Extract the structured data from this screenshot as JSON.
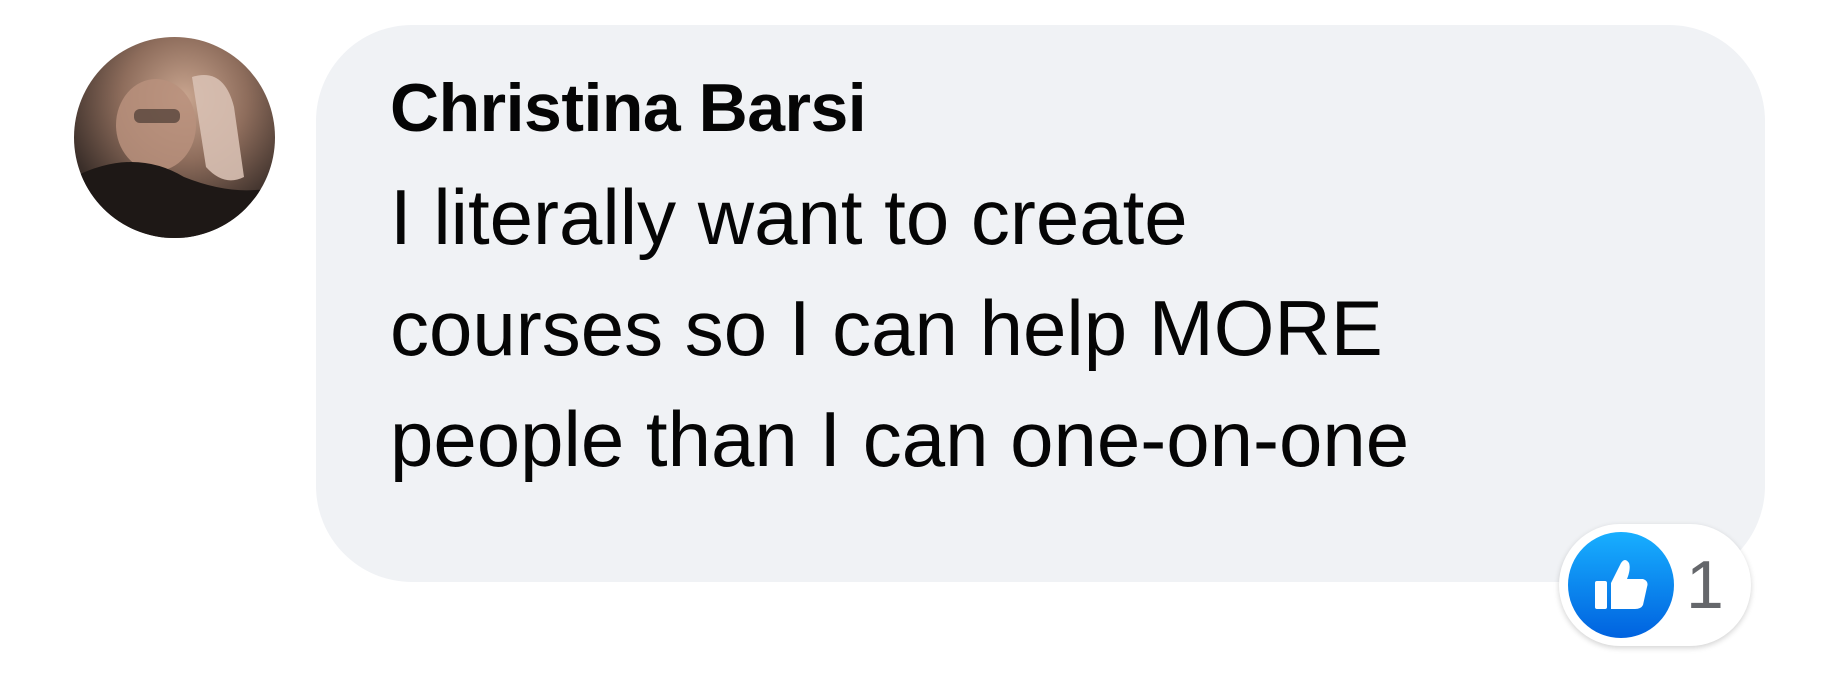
{
  "comment": {
    "author": "Christina Barsi",
    "lines": [
      "I literally want to create",
      "courses so I can help MORE",
      "people than I can one-on-one"
    ],
    "avatar_icon": "user-photo",
    "reaction": {
      "icon": "thumbs-up-icon",
      "count": "1",
      "color": "#1877f2"
    },
    "bubble_color": "#f0f2f5"
  }
}
